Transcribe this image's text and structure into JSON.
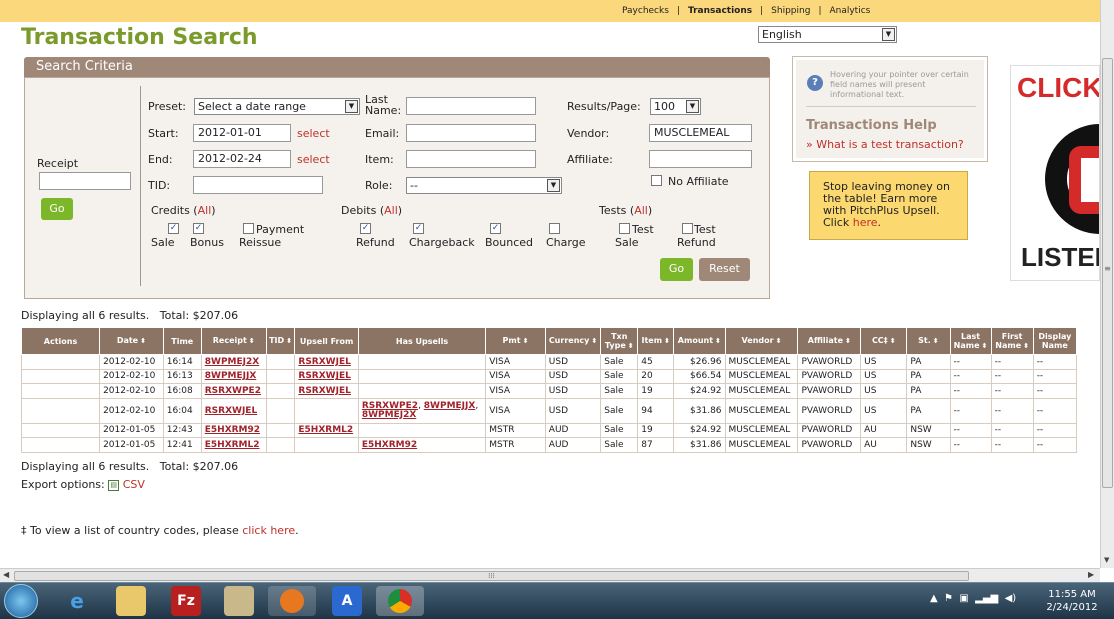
{
  "nav": {
    "items": [
      "Paychecks",
      "Transactions",
      "Shipping",
      "Analytics"
    ],
    "separator": "|"
  },
  "page_title": "Transaction Search",
  "language_select": {
    "value": "English"
  },
  "criteria": {
    "header": "Search Criteria",
    "receipt": {
      "label": "Receipt",
      "value": ""
    },
    "go_label": "Go",
    "reset_label": "Reset",
    "preset": {
      "label": "Preset:",
      "value": "Select a date range"
    },
    "start": {
      "label": "Start:",
      "value": "2012-01-01",
      "link": "select"
    },
    "end": {
      "label": "End:",
      "value": "2012-02-24",
      "link": "select"
    },
    "tid": {
      "label": "TID:",
      "value": ""
    },
    "last_name": {
      "label": "Last Name:",
      "value": ""
    },
    "email": {
      "label": "Email:",
      "value": ""
    },
    "item": {
      "label": "Item:",
      "value": ""
    },
    "role": {
      "label": "Role:",
      "value": "--"
    },
    "results_per_page": {
      "label": "Results/Page:",
      "value": "100"
    },
    "vendor": {
      "label": "Vendor:",
      "value": "MUSCLEMEAL"
    },
    "affiliate": {
      "label": "Affiliate:",
      "value": ""
    },
    "no_affiliate": {
      "label": "No Affiliate",
      "checked": false
    },
    "credits": {
      "label": "Credits",
      "all": "All",
      "items": [
        {
          "label": "Sale",
          "checked": true
        },
        {
          "label": "Bonus",
          "checked": true
        },
        {
          "label": "Payment Reissue",
          "checked": false
        }
      ]
    },
    "debits": {
      "label": "Debits",
      "all": "All",
      "items": [
        {
          "label": "Refund",
          "checked": true
        },
        {
          "label": "Chargeback",
          "checked": true
        },
        {
          "label": "Bounced",
          "checked": true
        },
        {
          "label": "Charge",
          "checked": false
        }
      ]
    },
    "tests": {
      "label": "Tests",
      "all": "All",
      "items": [
        {
          "label": "Test Sale",
          "checked": false
        },
        {
          "label": "Test Refund",
          "checked": false
        }
      ]
    }
  },
  "help": {
    "hover_text": "Hovering your pointer over certain field names will present informational text.",
    "title": "Transactions Help",
    "link": "What is a test transaction?"
  },
  "promo": {
    "text": "Stop leaving money on the table! Earn more with PitchPlus Upsell. Click ",
    "link": "here",
    "end": "."
  },
  "ad": {
    "top": "CLICK",
    "bottom": "LISTEN"
  },
  "summary": {
    "displaying": "Displaying all 6 results.",
    "total": "Total: $207.06"
  },
  "table": {
    "headers": [
      "Actions",
      "Date",
      "Time",
      "Receipt",
      "TID",
      "Upsell From",
      "Has Upsells",
      "Pmt",
      "Currency",
      "Txn Type",
      "Item",
      "Amount",
      "Vendor",
      "Affiliate",
      "CC‡",
      "St.",
      "Last Name",
      "First Name",
      "Display Name"
    ],
    "rows": [
      {
        "actions": "",
        "date": "2012-02-10",
        "time": "16:14",
        "receipt": "8WPMEJ2X",
        "tid": "",
        "upsell_from": "RSRXWJEL",
        "has_upsells": "",
        "pmt": "VISA",
        "currency": "USD",
        "txn_type": "Sale",
        "item": "45",
        "amount": "$26.96",
        "vendor": "MUSCLEMEAL",
        "affiliate": "PVAWORLD",
        "cc": "US",
        "st": "PA",
        "last_name": "--",
        "first_name": "--",
        "display_name": "--"
      },
      {
        "actions": "",
        "date": "2012-02-10",
        "time": "16:13",
        "receipt": "8WPMEJJX",
        "tid": "",
        "upsell_from": "RSRXWJEL",
        "has_upsells": "",
        "pmt": "VISA",
        "currency": "USD",
        "txn_type": "Sale",
        "item": "20",
        "amount": "$66.54",
        "vendor": "MUSCLEMEAL",
        "affiliate": "PVAWORLD",
        "cc": "US",
        "st": "PA",
        "last_name": "--",
        "first_name": "--",
        "display_name": "--"
      },
      {
        "actions": "",
        "date": "2012-02-10",
        "time": "16:08",
        "receipt": "RSRXWPE2",
        "tid": "",
        "upsell_from": "RSRXWJEL",
        "has_upsells": "",
        "pmt": "VISA",
        "currency": "USD",
        "txn_type": "Sale",
        "item": "19",
        "amount": "$24.92",
        "vendor": "MUSCLEMEAL",
        "affiliate": "PVAWORLD",
        "cc": "US",
        "st": "PA",
        "last_name": "--",
        "first_name": "--",
        "display_name": "--"
      },
      {
        "actions": "",
        "date": "2012-02-10",
        "time": "16:04",
        "receipt": "RSRXWJEL",
        "tid": "",
        "upsell_from": "",
        "has_upsells": [
          "RSRXWPE2",
          "8WPMEJJX",
          "8WPMEJ2X"
        ],
        "pmt": "VISA",
        "currency": "USD",
        "txn_type": "Sale",
        "item": "94",
        "amount": "$31.86",
        "vendor": "MUSCLEMEAL",
        "affiliate": "PVAWORLD",
        "cc": "US",
        "st": "PA",
        "last_name": "--",
        "first_name": "--",
        "display_name": "--"
      },
      {
        "actions": "",
        "date": "2012-01-05",
        "time": "12:43",
        "receipt": "E5HXRM92",
        "tid": "",
        "upsell_from": "E5HXRML2",
        "has_upsells": "",
        "pmt": "MSTR",
        "currency": "AUD",
        "txn_type": "Sale",
        "item": "19",
        "amount": "$24.92",
        "vendor": "MUSCLEMEAL",
        "affiliate": "PVAWORLD",
        "cc": "AU",
        "st": "NSW",
        "last_name": "--",
        "first_name": "--",
        "display_name": "--"
      },
      {
        "actions": "",
        "date": "2012-01-05",
        "time": "12:41",
        "receipt": "E5HXRML2",
        "tid": "",
        "upsell_from": "",
        "has_upsells": "E5HXRM92",
        "pmt": "MSTR",
        "currency": "AUD",
        "txn_type": "Sale",
        "item": "87",
        "amount": "$31.86",
        "vendor": "MUSCLEMEAL",
        "affiliate": "PVAWORLD",
        "cc": "AU",
        "st": "NSW",
        "last_name": "--",
        "first_name": "--",
        "display_name": "--"
      }
    ]
  },
  "export": {
    "label": "Export options:",
    "csv": "CSV"
  },
  "footnote": {
    "text": "‡ To view a list of country codes, please ",
    "link": "click here",
    "end": "."
  },
  "taskbar": {
    "time": "11:55 AM",
    "date": "2/24/2012"
  },
  "colors": {
    "title_green": "#7a9a2a",
    "header_brown": "#8c7464",
    "link_red": "#c0302a",
    "nav_yellow": "#fcd87c"
  }
}
